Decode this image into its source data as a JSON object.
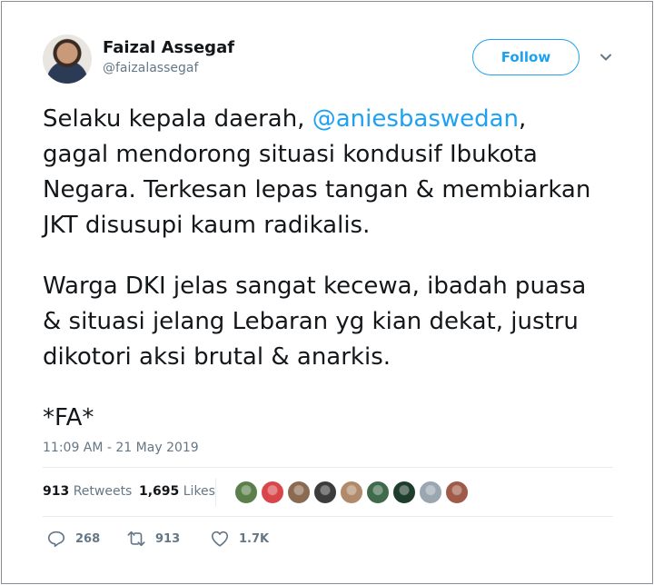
{
  "author": {
    "name": "Faizal Assegaf",
    "handle": "@faizalassegaf",
    "avatar_icon": "user-avatar"
  },
  "follow_label": "Follow",
  "tweet": {
    "lines_p1": [
      "Selaku kepala daerah, ",
      "gagal mendorong situasi kondusif Ibukota",
      "Negara. Terkesan lepas tangan & membiarkan",
      "JKT disusupi kaum radikalis."
    ],
    "mention": "@aniesbaswedan",
    "mention_suffix": ",",
    "lines_p2": [
      "Warga DKI jelas sangat kecewa, ibadah puasa",
      "& situasi jelang Lebaran yg kian dekat, justru",
      "dikotori aksi brutal & anarkis."
    ],
    "signature": "*FA*"
  },
  "timestamp": "11:09 AM - 21 May 2019",
  "stats": {
    "retweets_count": "913",
    "retweets_label": "Retweets",
    "likes_count": "1,695",
    "likes_label": "Likes"
  },
  "liker_avatars": [
    "#5b7f4a",
    "#d8464a",
    "#8a6a50",
    "#3c3c3c",
    "#b08a6a",
    "#3f6a4c",
    "#1f3d2c",
    "#9aa6b0",
    "#a05a48"
  ],
  "actions": {
    "reply_count": "268",
    "retweet_count": "913",
    "like_count": "1.7K"
  },
  "colors": {
    "accent": "#1da1f2",
    "muted": "#657786",
    "text": "#14171a"
  }
}
